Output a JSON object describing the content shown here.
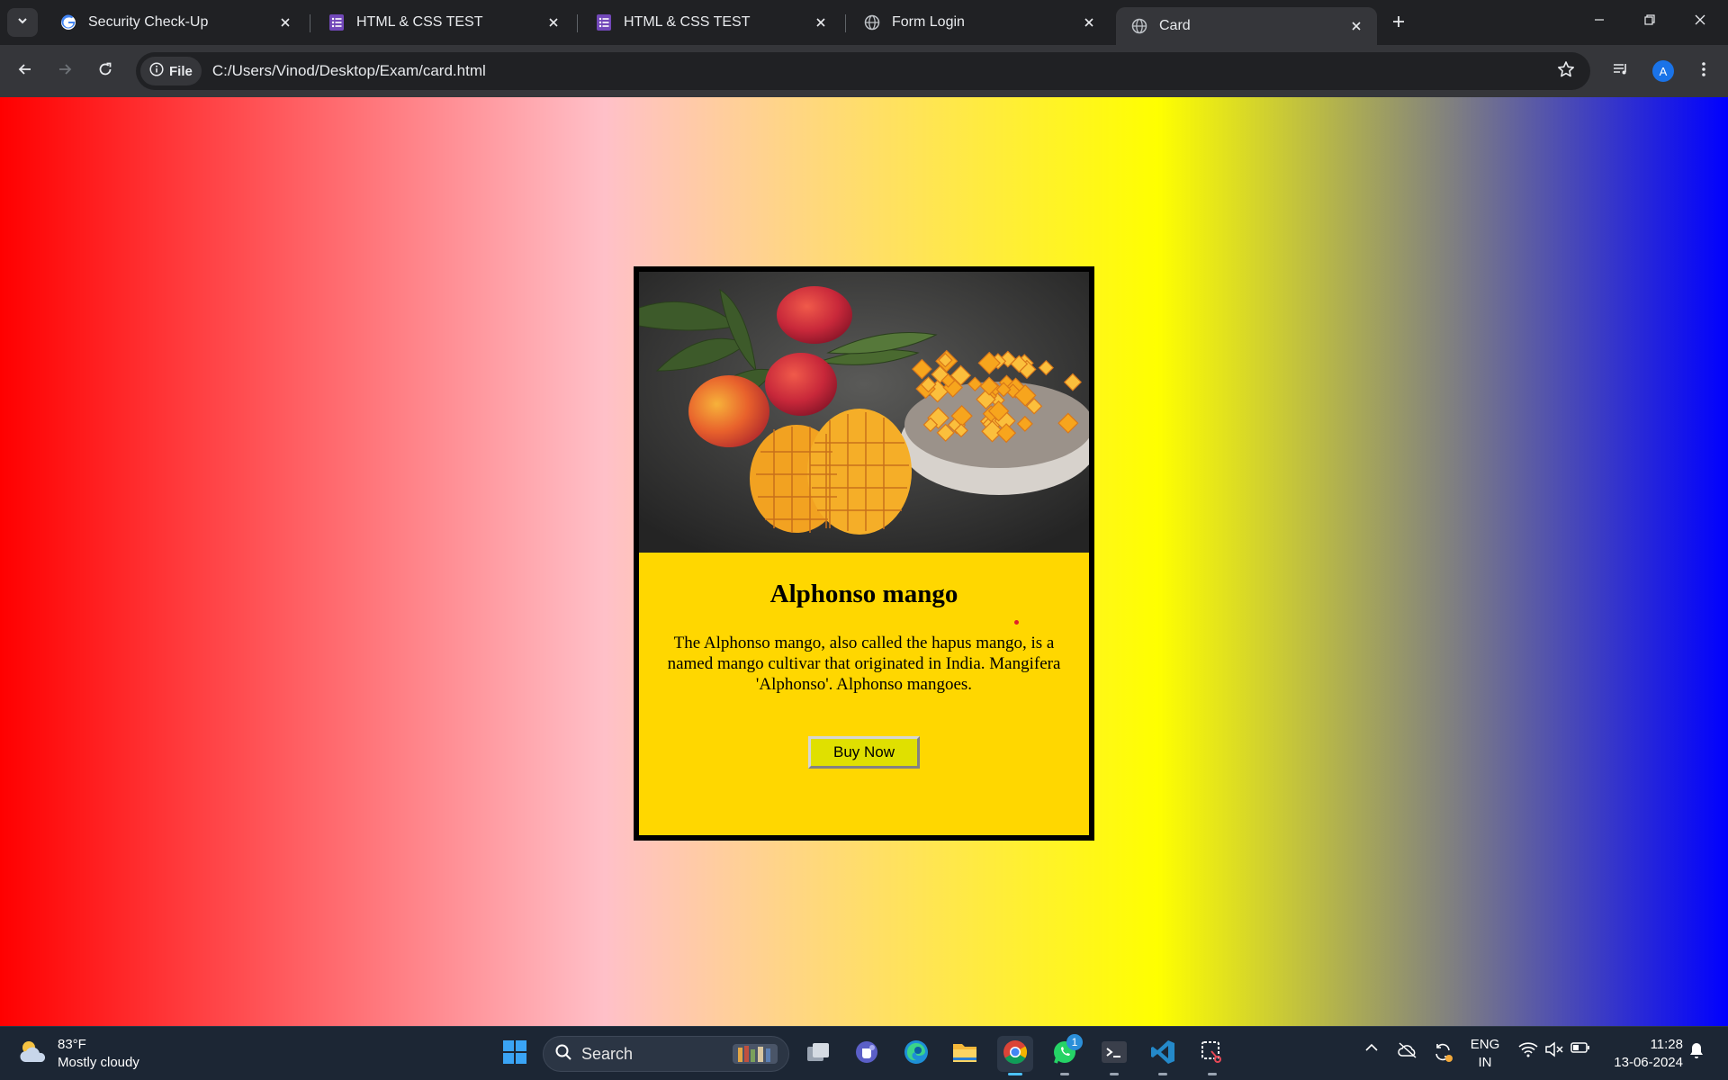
{
  "browser": {
    "tabs": [
      {
        "title": "Security Check-Up",
        "icon": "google-icon"
      },
      {
        "title": "HTML & CSS TEST",
        "icon": "forms-icon"
      },
      {
        "title": "HTML & CSS TEST",
        "icon": "forms-icon"
      },
      {
        "title": "Form Login",
        "icon": "globe-icon"
      },
      {
        "title": "Card",
        "icon": "globe-icon",
        "active": true
      }
    ],
    "address": {
      "chip_label": "File",
      "url": "C:/Users/Vinod/Desktop/Exam/card.html"
    },
    "profile_initial": "A"
  },
  "page": {
    "background_colors": [
      "#ff0000",
      "#ffc0c8",
      "#ffff00",
      "#808080",
      "#0000ff"
    ],
    "card": {
      "image_alt": "Alphonso mangoes with sliced mango cubes in a bowl",
      "title": "Alphonso mango",
      "description": "The Alphonso mango, also called the hapus mango, is a named mango cultivar that originated in India. Mangifera 'Alphonso'. Alphonso mangoes.",
      "button_label": "Buy Now",
      "background": "#ffd700"
    }
  },
  "taskbar": {
    "weather": {
      "temperature": "83°F",
      "condition": "Mostly cloudy"
    },
    "search_label": "Search",
    "whatsapp_badge": "1",
    "language": {
      "line1": "ENG",
      "line2": "IN"
    },
    "clock": {
      "time": "11:28",
      "date": "13-06-2024"
    }
  }
}
